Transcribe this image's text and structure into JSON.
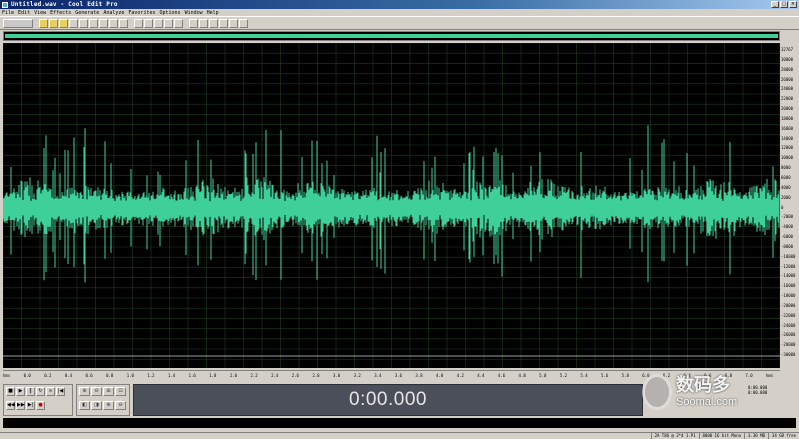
{
  "window": {
    "title": "Untitled.wav - Cool Edit Pro",
    "buttons": [
      "_",
      "□",
      "×"
    ]
  },
  "menu": [
    "File",
    "Edit",
    "View",
    "Effects",
    "Generate",
    "Analyze",
    "Favorites",
    "Options",
    "Window",
    "Help"
  ],
  "toolbar": {
    "icons": [
      "multitrack-toggle-icon",
      "new-icon",
      "open-icon",
      "save-icon",
      "undo-icon",
      "cut-icon",
      "copy-icon",
      "paste-icon",
      "mix-paste-icon",
      "trim-icon",
      "play-icon",
      "settings-icon",
      "zoom-icon",
      "frequency-icon",
      "cue-icon",
      "marker-icon",
      "loop-icon",
      "scope-icon",
      "meter-icon",
      "spectral-icon",
      "help-icon"
    ]
  },
  "waveform": {
    "color": "#3fd09a",
    "background": "#000000",
    "grid_color": "#1f3d1f"
  },
  "db_scale": {
    "labels": [
      "32767",
      "30000",
      "28000",
      "26000",
      "24000",
      "22000",
      "20000",
      "18000",
      "16000",
      "14000",
      "12000",
      "10000",
      "8000",
      "6000",
      "4000",
      "2000",
      "0",
      "-2000",
      "-4000",
      "-6000",
      "-8000",
      "-10000",
      "-12000",
      "-14000",
      "-16000",
      "-18000",
      "-20000",
      "-22000",
      "-24000",
      "-26000",
      "-28000",
      "-30000"
    ]
  },
  "time_ruler": {
    "labels": [
      "hms",
      "0.0",
      "0.2",
      "0.4",
      "0.6",
      "0.8",
      "1.0",
      "1.2",
      "1.4",
      "1.6",
      "1.8",
      "2.0",
      "2.2",
      "2.4",
      "2.6",
      "2.8",
      "3.0",
      "3.2",
      "3.4",
      "3.6",
      "3.8",
      "4.0",
      "4.2",
      "4.4",
      "4.6",
      "4.8",
      "5.0",
      "5.2",
      "5.4",
      "5.6",
      "5.8",
      "6.0",
      "6.2",
      "6.4",
      "6.6",
      "6.8",
      "7.0",
      "hms"
    ]
  },
  "transport": {
    "buttons": [
      {
        "name": "stop-icon",
        "glyph": "■"
      },
      {
        "name": "play-icon",
        "glyph": "▶"
      },
      {
        "name": "pause-icon",
        "glyph": "‖"
      },
      {
        "name": "play-to-end-icon",
        "glyph": "↻"
      },
      {
        "name": "loop-icon",
        "glyph": "∞"
      },
      {
        "name": "go-start-icon",
        "glyph": "|◀"
      },
      {
        "name": "rewind-icon",
        "glyph": "◀◀"
      },
      {
        "name": "fast-forward-icon",
        "glyph": "▶▶"
      },
      {
        "name": "go-end-icon",
        "glyph": "▶|"
      },
      {
        "name": "record-icon",
        "glyph": "●"
      }
    ]
  },
  "zoom": {
    "buttons": [
      {
        "name": "zoom-in-horizontal-icon",
        "glyph": "⊕"
      },
      {
        "name": "zoom-out-horizontal-icon",
        "glyph": "⊖"
      },
      {
        "name": "zoom-full-icon",
        "glyph": "⊞"
      },
      {
        "name": "zoom-selection-icon",
        "glyph": "⊡"
      },
      {
        "name": "zoom-left-icon",
        "glyph": "◧"
      },
      {
        "name": "zoom-right-icon",
        "glyph": "◨"
      },
      {
        "name": "zoom-in-vertical-icon",
        "glyph": "⊕"
      },
      {
        "name": "zoom-out-vertical-icon",
        "glyph": "⊖"
      }
    ]
  },
  "time_display": "0:00.000",
  "selection": {
    "begin": "0:00.000",
    "end": "0:00.000"
  },
  "status": {
    "cells": [
      "2A T86 @ 3*4 1.P1",
      "8000 16 bit Mono",
      "3.30 MB",
      "34 GB free"
    ]
  },
  "watermark": {
    "cn": "数码多",
    "url": "Soomal.com"
  }
}
